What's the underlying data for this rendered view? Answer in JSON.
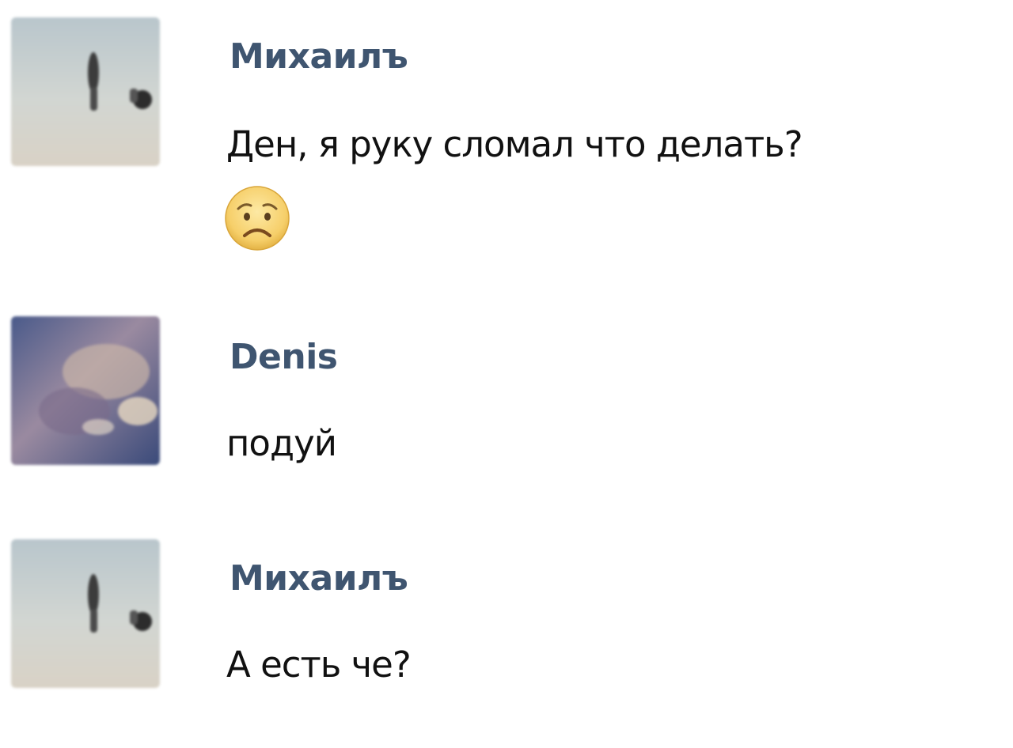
{
  "theme": {
    "author_color": "#3f5570",
    "text_color": "#111111",
    "background": "#ffffff"
  },
  "messages": [
    {
      "author": "Михаилъ",
      "avatar_icon": "avatar-beach-photo",
      "text": "Ден, я руку сломал что делать?",
      "emoji": "worried-face-emoji"
    },
    {
      "author": "Denis",
      "avatar_icon": "avatar-blurred-photo",
      "text": "подуй"
    },
    {
      "author": "Михаилъ",
      "avatar_icon": "avatar-beach-photo",
      "text": "А есть че?"
    }
  ]
}
